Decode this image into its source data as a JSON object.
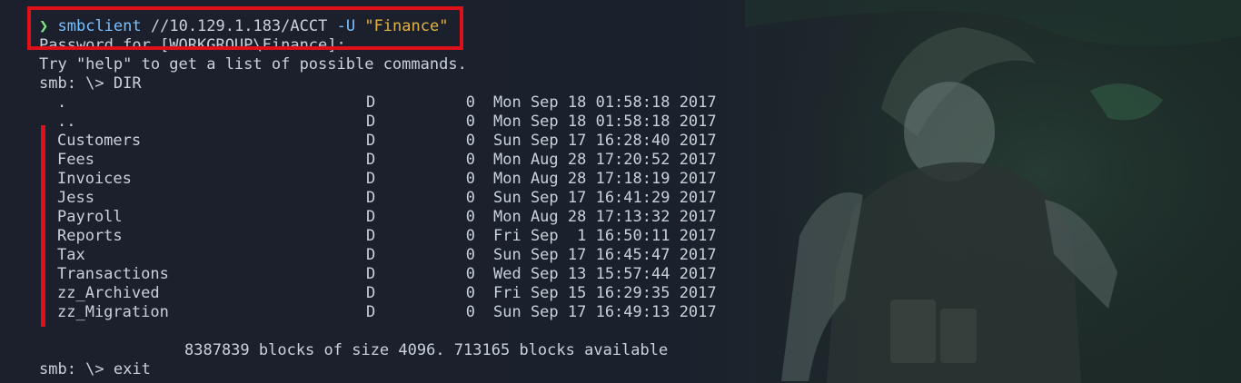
{
  "terminal": {
    "prompt_symbol": "❯",
    "command": {
      "program": "smbclient",
      "target": "//10.129.1.183/ACCT",
      "flag": "-U",
      "user": "\"Finance\""
    },
    "password_prompt": "Password for [WORKGROUP\\Finance]:",
    "help_hint": "Try \"help\" to get a list of possible commands.",
    "dir_prompt": "smb: \\> DIR",
    "listing": [
      {
        "name": ".",
        "type": "D",
        "size": "0",
        "date": "Mon Sep 18 01:58:18 2017"
      },
      {
        "name": "..",
        "type": "D",
        "size": "0",
        "date": "Mon Sep 18 01:58:18 2017"
      },
      {
        "name": "Customers",
        "type": "D",
        "size": "0",
        "date": "Sun Sep 17 16:28:40 2017"
      },
      {
        "name": "Fees",
        "type": "D",
        "size": "0",
        "date": "Mon Aug 28 17:20:52 2017"
      },
      {
        "name": "Invoices",
        "type": "D",
        "size": "0",
        "date": "Mon Aug 28 17:18:19 2017"
      },
      {
        "name": "Jess",
        "type": "D",
        "size": "0",
        "date": "Sun Sep 17 16:41:29 2017"
      },
      {
        "name": "Payroll",
        "type": "D",
        "size": "0",
        "date": "Mon Aug 28 17:13:32 2017"
      },
      {
        "name": "Reports",
        "type": "D",
        "size": "0",
        "date": "Fri Sep  1 16:50:11 2017"
      },
      {
        "name": "Tax",
        "type": "D",
        "size": "0",
        "date": "Sun Sep 17 16:45:47 2017"
      },
      {
        "name": "Transactions",
        "type": "D",
        "size": "0",
        "date": "Wed Sep 13 15:57:44 2017"
      },
      {
        "name": "zz_Archived",
        "type": "D",
        "size": "0",
        "date": "Fri Sep 15 16:29:35 2017"
      },
      {
        "name": "zz_Migration",
        "type": "D",
        "size": "0",
        "date": "Sun Sep 17 16:49:13 2017"
      }
    ],
    "summary": "8387839 blocks of size 4096. 713165 blocks available",
    "exit_prompt": "smb: \\> exit"
  },
  "colors": {
    "background": "#1b202c",
    "text": "#c9d1d9",
    "prompt_arrow": "#7ee787",
    "command": "#79c0ff",
    "string": "#e3b341",
    "highlight": "#e0101a"
  },
  "icons": {
    "background_art": "anime-character-art"
  }
}
